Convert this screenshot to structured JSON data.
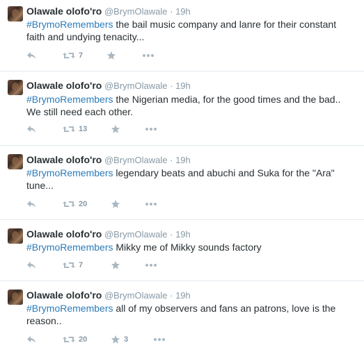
{
  "tweets": [
    {
      "name": "Olawale olofo'ro",
      "handle": "@BrymOlawale",
      "dot": "·",
      "time": "19h",
      "hashtag": "#BrymoRemembers",
      "text": " the bail music company and lanre for their constant faith and undying tenacity...",
      "retweets": "7",
      "favorites": ""
    },
    {
      "name": "Olawale olofo'ro",
      "handle": "@BrymOlawale",
      "dot": "·",
      "time": "19h",
      "hashtag": "#BrymoRemembers",
      "text": " the Nigerian media, for the good times and the bad.. We still need each other.",
      "retweets": "13",
      "favorites": ""
    },
    {
      "name": "Olawale olofo'ro",
      "handle": "@BrymOlawale",
      "dot": "·",
      "time": "19h",
      "hashtag": "#BrymoRemembers",
      "text": " legendary beats and abuchi and Suka for the \"Ara\" tune...",
      "retweets": "20",
      "favorites": ""
    },
    {
      "name": "Olawale olofo'ro",
      "handle": "@BrymOlawale",
      "dot": "·",
      "time": "19h",
      "hashtag": "#BrymoRemembers",
      "text": " Mikky me of Mikky sounds factory",
      "retweets": "7",
      "favorites": ""
    },
    {
      "name": "Olawale olofo'ro",
      "handle": "@BrymOlawale",
      "dot": "·",
      "time": "19h",
      "hashtag": "#BrymoRemembers",
      "text": " all of my observers and fans an patrons, love is the reason..",
      "retweets": "20",
      "favorites": "3"
    }
  ],
  "icons": {
    "reply": "reply-icon",
    "retweet": "retweet-icon",
    "favorite": "star-icon",
    "more": "more-icon"
  },
  "colors": {
    "hashtag": "#2b7bb9",
    "meta": "#8899a6",
    "icon": "#aab8c2",
    "divider": "#e1e8ed"
  }
}
